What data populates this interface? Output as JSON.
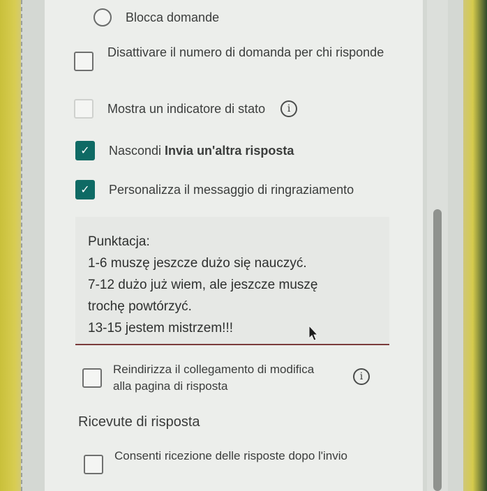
{
  "options": {
    "block_questions": {
      "label": "Blocca domande"
    },
    "disable_question_number": {
      "label": "Disattivare il numero di domanda per chi risponde"
    },
    "show_progress": {
      "label": "Mostra un indicatore di stato",
      "info": "i"
    },
    "hide_submit_another": {
      "label_prefix": "Nascondi ",
      "label_bold": "Invia un'altra risposta",
      "checked": true,
      "check": "✓"
    },
    "custom_thank_you": {
      "label": "Personalizza il messaggio di ringraziamento",
      "checked": true,
      "check": "✓"
    }
  },
  "thank_you_message": {
    "lines": [
      "Punktacja:",
      "1-6  muszę jeszcze dużo się nauczyć.",
      "7-12 dużo już wiem, ale jeszcze muszę",
      "trochę powtórzyć.",
      "13-15 jestem mistrzem!!!"
    ]
  },
  "redirect_edit_link": {
    "label": "Reindirizza il collegamento di modifica alla pagina di risposta",
    "info": "i"
  },
  "response_receipts": {
    "title": "Ricevute di risposta",
    "allow_receipt": {
      "label": "Consenti ricezione delle risposte dopo l'invio"
    }
  },
  "colors": {
    "checkbox_checked": "#0e6a64",
    "textarea_underline": "#7a3b3b"
  }
}
